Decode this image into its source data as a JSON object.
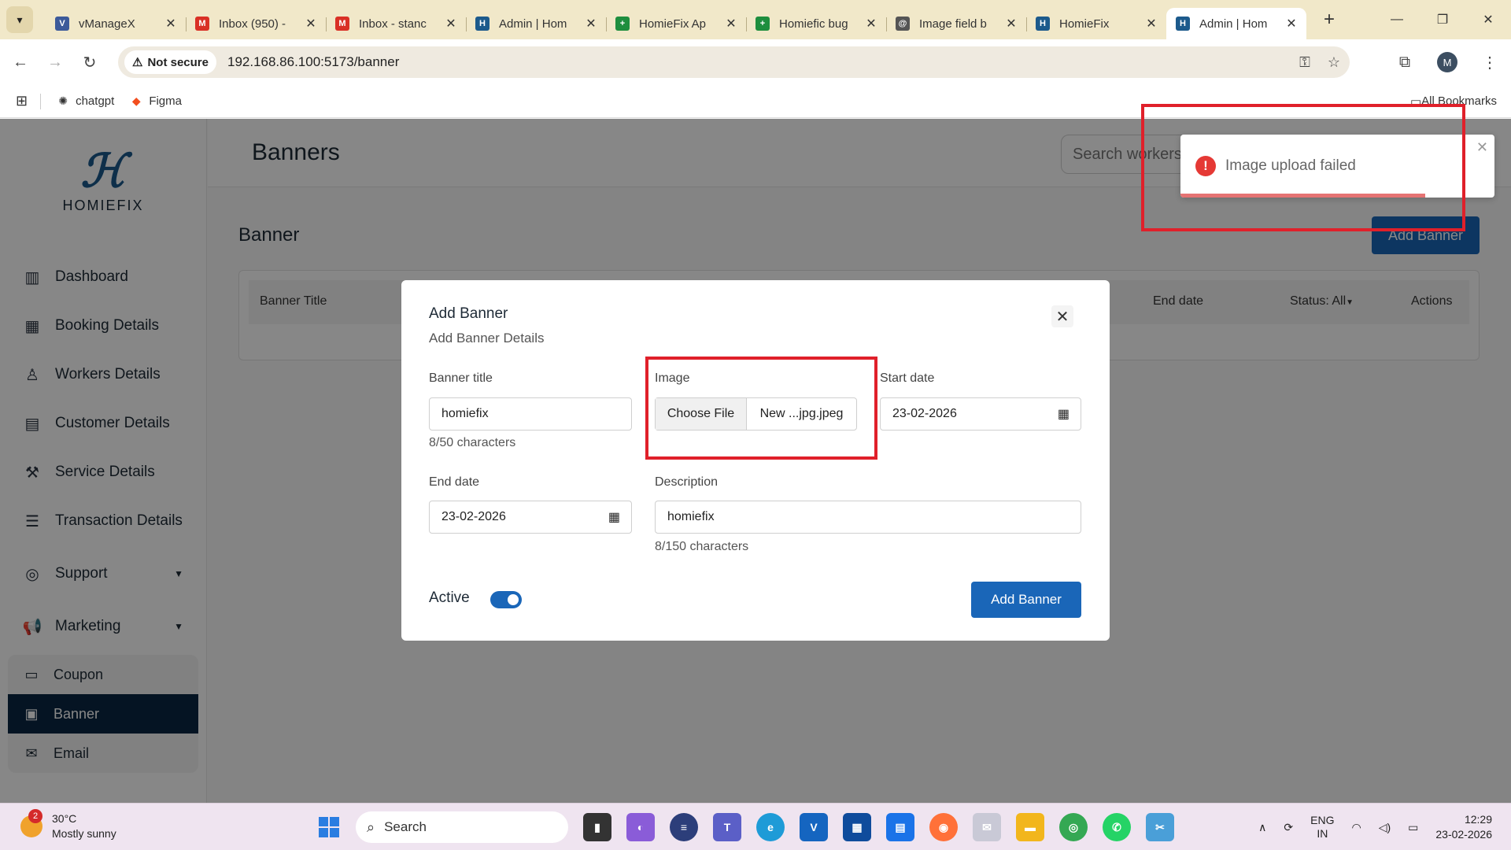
{
  "browser": {
    "tabs": [
      {
        "title": "vManageX",
        "fav_color": "#3c5a9a",
        "fav_glyph": "V"
      },
      {
        "title": "Inbox (950) -",
        "fav_color": "#d93025",
        "fav_glyph": "M"
      },
      {
        "title": "Inbox - stanc",
        "fav_color": "#d93025",
        "fav_glyph": "M"
      },
      {
        "title": "Admin | Hom",
        "fav_color": "#1c5a8c",
        "fav_glyph": "H"
      },
      {
        "title": "HomieFix Ap",
        "fav_color": "#1e8e3e",
        "fav_glyph": "+"
      },
      {
        "title": "Homiefic bug",
        "fav_color": "#1e8e3e",
        "fav_glyph": "+"
      },
      {
        "title": "Image field b",
        "fav_color": "#555555",
        "fav_glyph": "@"
      },
      {
        "title": "HomieFix",
        "fav_color": "#1c5a8c",
        "fav_glyph": "H"
      },
      {
        "title": "Admin | Hom",
        "fav_color": "#1c5a8c",
        "fav_glyph": "H",
        "active": true
      }
    ],
    "security_label": "Not secure",
    "url": "192.168.86.100:5173/banner",
    "profile_initial": "M",
    "bookmarks": [
      {
        "label": "chatgpt"
      },
      {
        "label": "Figma"
      }
    ],
    "all_bookmarks_label": "All Bookmarks"
  },
  "app": {
    "logo_text": "HOMIEFIX",
    "nav": [
      {
        "label": "Dashboard",
        "icon": "chart-icon"
      },
      {
        "label": "Booking Details",
        "icon": "calendar-icon"
      },
      {
        "label": "Workers Details",
        "icon": "users-icon"
      },
      {
        "label": "Customer Details",
        "icon": "document-icon"
      },
      {
        "label": "Service Details",
        "icon": "hammer-icon"
      },
      {
        "label": "Transaction Details",
        "icon": "receipt-icon"
      },
      {
        "label": "Support",
        "icon": "headset-icon"
      },
      {
        "label": "Marketing",
        "icon": "megaphone-icon"
      }
    ],
    "subnav": [
      {
        "label": "Coupon",
        "icon": "ticket-icon"
      },
      {
        "label": "Banner",
        "icon": "banner-icon",
        "active": true
      },
      {
        "label": "Email",
        "icon": "mail-icon"
      }
    ],
    "page_title": "Banners",
    "search_placeholder": "Search workers",
    "section_title": "Banner",
    "add_banner_button": "Add Banner",
    "table_headers": {
      "banner_title": "Banner Title",
      "end_date": "End date",
      "status": "Status: All",
      "actions": "Actions"
    }
  },
  "modal": {
    "title": "Add Banner",
    "subtitle": "Add Banner Details",
    "banner_title_label": "Banner title",
    "banner_title_value": "homiefix",
    "banner_title_count": "8/50 characters",
    "image_label": "Image",
    "choose_file_label": "Choose File",
    "file_name": "New ...jpg.jpeg",
    "start_date_label": "Start date",
    "start_date_value": "23-02-2026",
    "end_date_label": "End date",
    "end_date_value": "23-02-2026",
    "description_label": "Description",
    "description_value": "homiefix",
    "description_count": "8/150 characters",
    "active_label": "Active",
    "active_on": true,
    "submit_label": "Add Banner"
  },
  "toast": {
    "message": "Image upload failed",
    "type": "error",
    "progress": 0.78
  },
  "taskbar": {
    "weather_temp": "30°C",
    "weather_desc": "Mostly sunny",
    "weather_badge": "2",
    "search_label": "Search",
    "lang_primary": "ENG",
    "lang_secondary": "IN",
    "time": "12:29",
    "date": "23-02-2026"
  },
  "colors": {
    "accent": "#1a66b8",
    "sidebar_active": "#0a2642",
    "error": "#e53935",
    "annotation": "#e0202a"
  }
}
